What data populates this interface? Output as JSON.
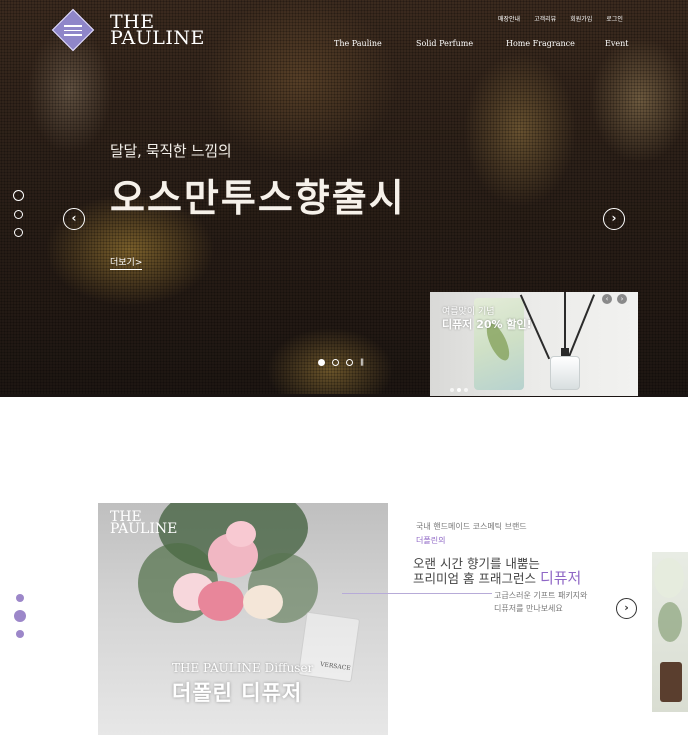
{
  "brand": {
    "line1": "THE",
    "line2": "PAULINE"
  },
  "utility_nav": [
    "매장안내",
    "고객리뷰",
    "회원가입",
    "로그인"
  ],
  "main_nav": [
    "The Pauline",
    "Solid Perfume",
    "Home Fragrance",
    "Event"
  ],
  "hero": {
    "subtitle": "달달, 묵직한 느낌의",
    "title": "오스만투스향출시",
    "more_link": "더보기>",
    "prev_icon": "chevron-left-icon",
    "next_icon": "chevron-right-icon",
    "slide_count": 4
  },
  "promo": {
    "line1": "여름맞이 기념",
    "line2": "디퓨저 20% 할인!"
  },
  "product": {
    "logo_line1": "THE",
    "logo_line2": "PAULINE",
    "name_en": "THE PAULINE Diffuser",
    "name_kr": "더폴린 디퓨저",
    "bottle_label": "VERSACE"
  },
  "intro": {
    "brand_line": "국내 핸드메이드 코스메틱 브랜드",
    "brand_name": "더폴린의",
    "headline1": "오랜 시간 향기를 내뿜는",
    "headline2": "프리미엄 홈 프래그런스",
    "headline_accent": "디퓨저",
    "desc1": "고급스러운 기프트 패키지와",
    "desc2": "디퓨저를 만나보세요"
  },
  "colors": {
    "accent": "#8f67c6",
    "logo_diamond": "#8f86c9",
    "dots": "#9c87c9"
  }
}
